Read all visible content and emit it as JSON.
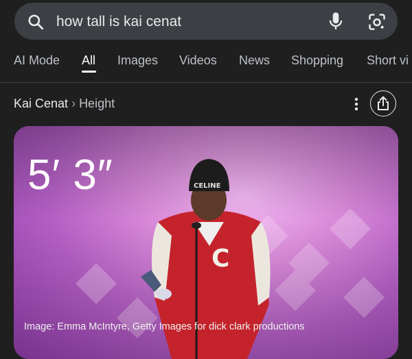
{
  "search": {
    "query": "how tall is kai cenat"
  },
  "tabs": [
    {
      "label": "AI Mode"
    },
    {
      "label": "All"
    },
    {
      "label": "Images"
    },
    {
      "label": "Videos"
    },
    {
      "label": "News"
    },
    {
      "label": "Shopping"
    },
    {
      "label": "Short vi"
    }
  ],
  "active_tab": "All",
  "result": {
    "entity": "Kai Cenat",
    "separator": "›",
    "attribute": "Height",
    "height_value": "5′ 3″",
    "image_caption": "Image: Emma McIntyre, Getty Images for dick clark productions"
  },
  "icons": {
    "search": "search-icon",
    "mic": "mic-icon",
    "lens": "google-lens-icon",
    "more": "more-vert-icon",
    "share": "share-icon"
  },
  "colors": {
    "background": "#1f1f1f",
    "search_bar": "#3c3f43",
    "text": "#e8eaed",
    "muted_text": "#bdc1c6"
  }
}
